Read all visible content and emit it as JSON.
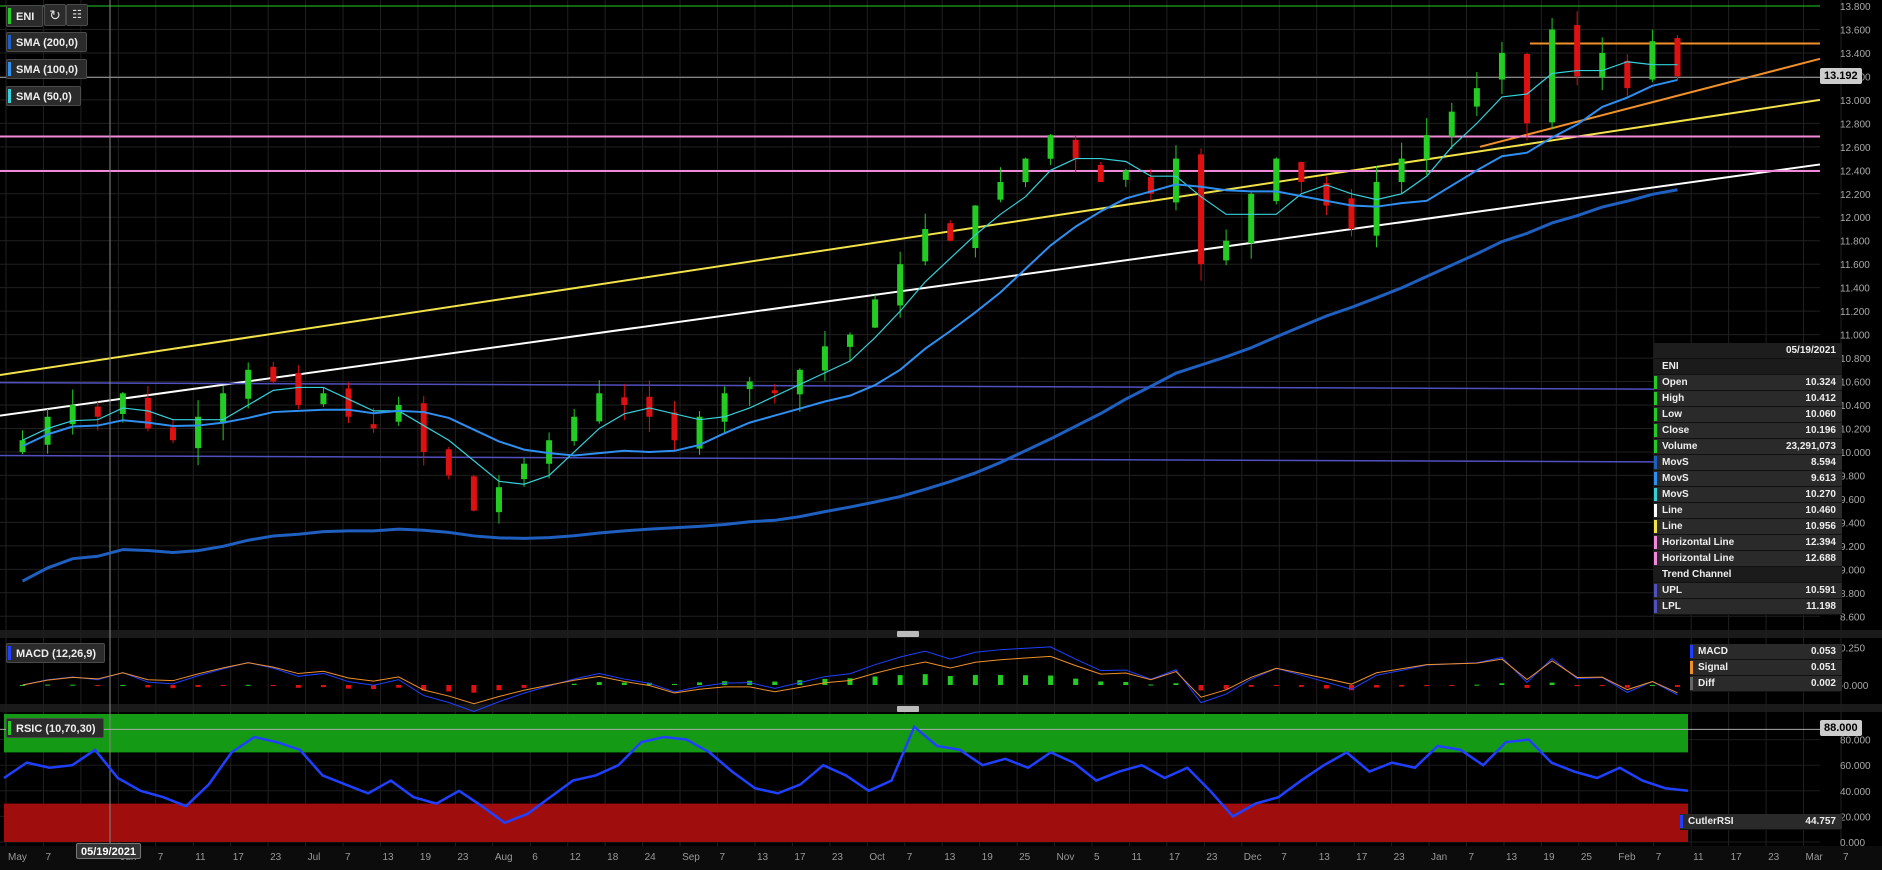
{
  "symbol": "ENI",
  "chips": {
    "sma200": "SMA (200,0)",
    "sma100": "SMA (100,0)",
    "sma50": "SMA (50,0)",
    "macd": "MACD (12,26,9)",
    "rsi": "RSIC (10,70,30)"
  },
  "colors": {
    "up": "#22cc22",
    "down": "#dd1111",
    "sma200": "#1f5fc0",
    "sma100": "#2f8ff0",
    "sma50": "#35d0d8",
    "white_line": "#ffffff",
    "yellow_line": "#f2e24a",
    "orange_line": "#f0902a",
    "pink_hline": "#f08ad8",
    "channel": "#5050c0",
    "rsi_line": "#2040ff",
    "rsi_over": "#159a15",
    "rsi_under": "#a00d0d"
  },
  "price_tag": "13.192",
  "rsi_tag": "88.000",
  "cursor_date": "05/19/2021",
  "datatable": {
    "date": "05/19/2021",
    "symbol": "ENI",
    "rows": [
      {
        "label": "Open",
        "value": "10.324",
        "color": "#22cc22"
      },
      {
        "label": "High",
        "value": "10.412",
        "color": "#22cc22"
      },
      {
        "label": "Low",
        "value": "10.060",
        "color": "#22cc22"
      },
      {
        "label": "Close",
        "value": "10.196",
        "color": "#22cc22"
      },
      {
        "label": "Volume",
        "value": "23,291,073",
        "color": "#22cc22"
      },
      {
        "label": "MovS",
        "value": "8.594",
        "color": "#1f5fc0"
      },
      {
        "label": "MovS",
        "value": "9.613",
        "color": "#2f8ff0"
      },
      {
        "label": "MovS",
        "value": "10.270",
        "color": "#35d0d8"
      },
      {
        "label": "Line",
        "value": "10.460",
        "color": "#ffffff"
      },
      {
        "label": "Line",
        "value": "10.956",
        "color": "#f2e24a"
      },
      {
        "label": "Horizontal Line",
        "value": "12.394",
        "color": "#f08ad8"
      },
      {
        "label": "Horizontal Line",
        "value": "12.688",
        "color": "#f08ad8"
      },
      {
        "label": "Trend Channel",
        "value": "",
        "color": ""
      },
      {
        "label": "UPL",
        "value": "10.591",
        "color": "#5050c0"
      },
      {
        "label": "LPL",
        "value": "11.198",
        "color": "#5050c0"
      }
    ]
  },
  "macd_table": [
    {
      "label": "MACD",
      "value": "0.053",
      "color": "#2040ff"
    },
    {
      "label": "Signal",
      "value": "0.051",
      "color": "#f0902a"
    },
    {
      "label": "Diff",
      "value": "0.002",
      "color": "#666666"
    }
  ],
  "rsi_table": {
    "label": "CutlerRSI",
    "value": "44.757",
    "color": "#2040ff"
  },
  "chart_data": [
    {
      "type": "candlestick",
      "title": "ENI",
      "ylim": [
        8.5,
        13.8
      ],
      "y_ticks": [
        "13.800",
        "13.600",
        "13.400",
        "13.200",
        "13.000",
        "12.800",
        "12.600",
        "12.400",
        "12.200",
        "12.000",
        "11.800",
        "11.600",
        "11.400",
        "11.200",
        "11.000",
        "10.800",
        "10.600",
        "10.400",
        "10.200",
        "10.000",
        "9.800",
        "9.600",
        "9.400",
        "9.200",
        "9.000",
        "8.800",
        "8.600"
      ],
      "x_ticks": [
        "May",
        "7",
        "",
        "Jun",
        "7",
        "11",
        "17",
        "23",
        "Jul",
        "7",
        "13",
        "19",
        "23",
        "Aug",
        "6",
        "12",
        "18",
        "24",
        "Sep",
        "7",
        "13",
        "17",
        "23",
        "Oct",
        "7",
        "13",
        "19",
        "25",
        "Nov",
        "5",
        "11",
        "17",
        "23",
        "Dec",
        "7",
        "13",
        "17",
        "23",
        "Jan",
        "7",
        "13",
        "19",
        "25",
        "Feb",
        "7",
        "11",
        "17",
        "23",
        "Mar",
        "7"
      ],
      "close_path": [
        10.1,
        10.3,
        10.4,
        10.3,
        10.5,
        10.2,
        10.1,
        10.3,
        10.5,
        10.7,
        10.6,
        10.4,
        10.5,
        10.3,
        10.2,
        10.4,
        10.0,
        9.8,
        9.5,
        9.7,
        9.9,
        10.1,
        10.3,
        10.5,
        10.4,
        10.3,
        10.1,
        10.3,
        10.5,
        10.6,
        10.5,
        10.7,
        10.9,
        11.0,
        11.3,
        11.6,
        11.9,
        11.8,
        12.1,
        12.3,
        12.5,
        12.7,
        12.5,
        12.3,
        12.4,
        12.2,
        12.5,
        11.6,
        11.8,
        12.2,
        12.5,
        12.3,
        12.1,
        11.9,
        12.3,
        12.5,
        12.7,
        12.9,
        13.1,
        13.4,
        12.8,
        13.6,
        13.2,
        13.4,
        13.1,
        13.5,
        13.2
      ],
      "series": [
        {
          "name": "SMA (200,0)",
          "last": 8.594
        },
        {
          "name": "SMA (100,0)",
          "last": 9.613
        },
        {
          "name": "SMA (50,0)",
          "last": 10.27
        }
      ],
      "horizontal_lines": [
        12.394,
        12.688
      ],
      "last_price": 13.192
    },
    {
      "type": "line",
      "title": "MACD (12,26,9)",
      "ylim": [
        -0.1,
        0.3
      ],
      "y_ticks": [
        "0.250",
        "-0.000"
      ],
      "series": [
        {
          "name": "MACD",
          "last": 0.053
        },
        {
          "name": "Signal",
          "last": 0.051
        },
        {
          "name": "Diff",
          "last": 0.002
        }
      ]
    },
    {
      "type": "line",
      "title": "RSIC (10,70,30)",
      "ylim": [
        0,
        100
      ],
      "y_ticks": [
        "80.000",
        "60.000",
        "40.000",
        "20.000",
        "0.000"
      ],
      "series": [
        {
          "name": "CutlerRSI",
          "values": [
            50,
            62,
            58,
            60,
            72,
            50,
            40,
            35,
            28,
            45,
            70,
            82,
            78,
            72,
            52,
            45,
            38,
            48,
            35,
            30,
            40,
            28,
            15,
            22,
            35,
            48,
            52,
            60,
            78,
            82,
            80,
            70,
            55,
            42,
            38,
            45,
            60,
            52,
            40,
            48,
            90,
            75,
            72,
            60,
            65,
            58,
            70,
            62,
            48,
            55,
            60,
            50,
            58,
            40,
            20,
            30,
            35,
            48,
            60,
            70,
            55,
            62,
            58,
            75,
            72,
            60,
            78,
            80,
            62,
            55,
            50,
            58,
            48,
            42,
            40
          ],
          "last": 44.757
        }
      ]
    }
  ]
}
